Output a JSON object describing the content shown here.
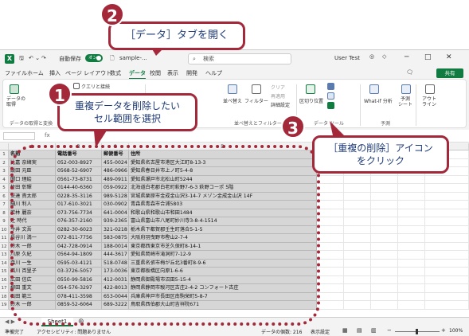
{
  "titlebar": {
    "autosave": "自動保存",
    "toggle": "オン",
    "filename": "sample-...",
    "search": "検索",
    "user": "User Test"
  },
  "menu": {
    "tabs": [
      "ファイル",
      "ホーム",
      "挿入",
      "ページ レイアウト",
      "数式",
      "データ",
      "校閲",
      "表示",
      "開発",
      "ヘルプ"
    ],
    "share": "共有"
  },
  "ribbon": {
    "get_data": "データの\n取得",
    "query_conn": "クエリと接続",
    "group_get": "データの取得と変換",
    "sort": "並べ替え",
    "filter": "フィルター",
    "clear": "クリア",
    "reapply": "再適用",
    "advanced": "詳細設定",
    "group_sort": "並べ替えとフィルター",
    "split": "区切り位置",
    "group_tools": "データ ツール",
    "whatif": "What-If 分析",
    "forecast": "予測\nシート",
    "group_forecast": "予測",
    "outline": "アウト\nライン"
  },
  "colheads": [
    "A",
    "B",
    "C",
    "D",
    "E",
    "F",
    "G",
    "H",
    "I",
    "J",
    "K",
    "L"
  ],
  "table": {
    "headers": [
      "名前",
      "電話番号",
      "郵便番号",
      "住所"
    ],
    "rows": [
      [
        "比嘉 奈緒実",
        "052-003-8927",
        "455-0024",
        "愛知県名古屋市港区大江町8-13-3"
      ],
      [
        "飯田 元臣",
        "0568-52-6907",
        "486-0966",
        "愛知県春日井市上ノ町5-4-8"
      ],
      [
        "関口 理絵",
        "0561-73-8731",
        "489-0911",
        "愛知県瀬戸市北松山町5244"
      ],
      [
        "竹田 彰輝",
        "0144-40-6360",
        "059-0922",
        "北海道白老郡白老町萩野7-6-3 萩野コーポ 5階"
      ],
      [
        "安達 貴太郎",
        "0228-35-3116",
        "989-5128",
        "宮城県栗原市金成金山沢3-14-7 メゾン金成金山沢 14F"
      ],
      [
        "細川 利人",
        "017-610-3021",
        "030-0902",
        "青森県青森市合浦5803"
      ],
      [
        "若林 麗奈",
        "073-756-7734",
        "641-0004",
        "和歌山県和歌山市和田1484"
      ],
      [
        "辻 時代",
        "076-357-2160",
        "939-2365",
        "富山県富山市八尾町妙川寺3-8-4-1514"
      ],
      [
        "今井 文吾",
        "0282-30-6023",
        "321-0218",
        "栃木県下都賀郡壬生町落合5-1-5"
      ],
      [
        "長谷川 満一",
        "072-811-7756",
        "583-0875",
        "大阪府羽曳野市樫山2-7-4"
      ],
      [
        "鈴木 一郎",
        "042-728-0914",
        "188-0014",
        "東京都西東京市芝久保町8-14-1"
      ],
      [
        "川原 久紀",
        "0564-94-1809",
        "444-3617",
        "愛知県岡崎市滝洞町7-12-9"
      ],
      [
        "森川 一生",
        "0595-03-4121",
        "518-0748",
        "三重県名張市梅が丘北3番町8-9-6"
      ],
      [
        "西川 百里子",
        "03-3726-5057",
        "173-0036",
        "東京都板橋区向原1-6-6"
      ],
      [
        "広田 信広",
        "0550-99-5816",
        "412-0031",
        "静岡県御殿場市沼田5-15-4"
      ],
      [
        "柳田 重文",
        "054-576-3297",
        "422-8013",
        "静岡県静岡市駿河区古庄2-4-2 コンフォート古庄"
      ],
      [
        "石田 範三",
        "078-411-3598",
        "653-0044",
        "兵庫県神戸市長田区南駒栄町5-8-7"
      ],
      [
        "鈴木 一郎",
        "0859-52-6064",
        "689-3222",
        "鳥取県西伯郡大山町吉祥院671"
      ]
    ]
  },
  "sheet": {
    "name": "Sheet1"
  },
  "status": {
    "ready": "準備完了",
    "accessibility": "アクセシビリティ: 問題ありません",
    "count": "データの個数: 216",
    "display": "表示設定",
    "zoom": "100%"
  },
  "callouts": {
    "c1_num": "1",
    "c1_text": "重複データを削除したい\nセル範囲を選択",
    "c2_num": "2",
    "c2_text": "［データ］タブを開く",
    "c3_num": "3",
    "c3_text": "［重複の削除］アイコン\nをクリック"
  },
  "colors": {
    "accent": "#107c41",
    "callout": "#a3283a",
    "callout_text": "#1e3a78"
  }
}
